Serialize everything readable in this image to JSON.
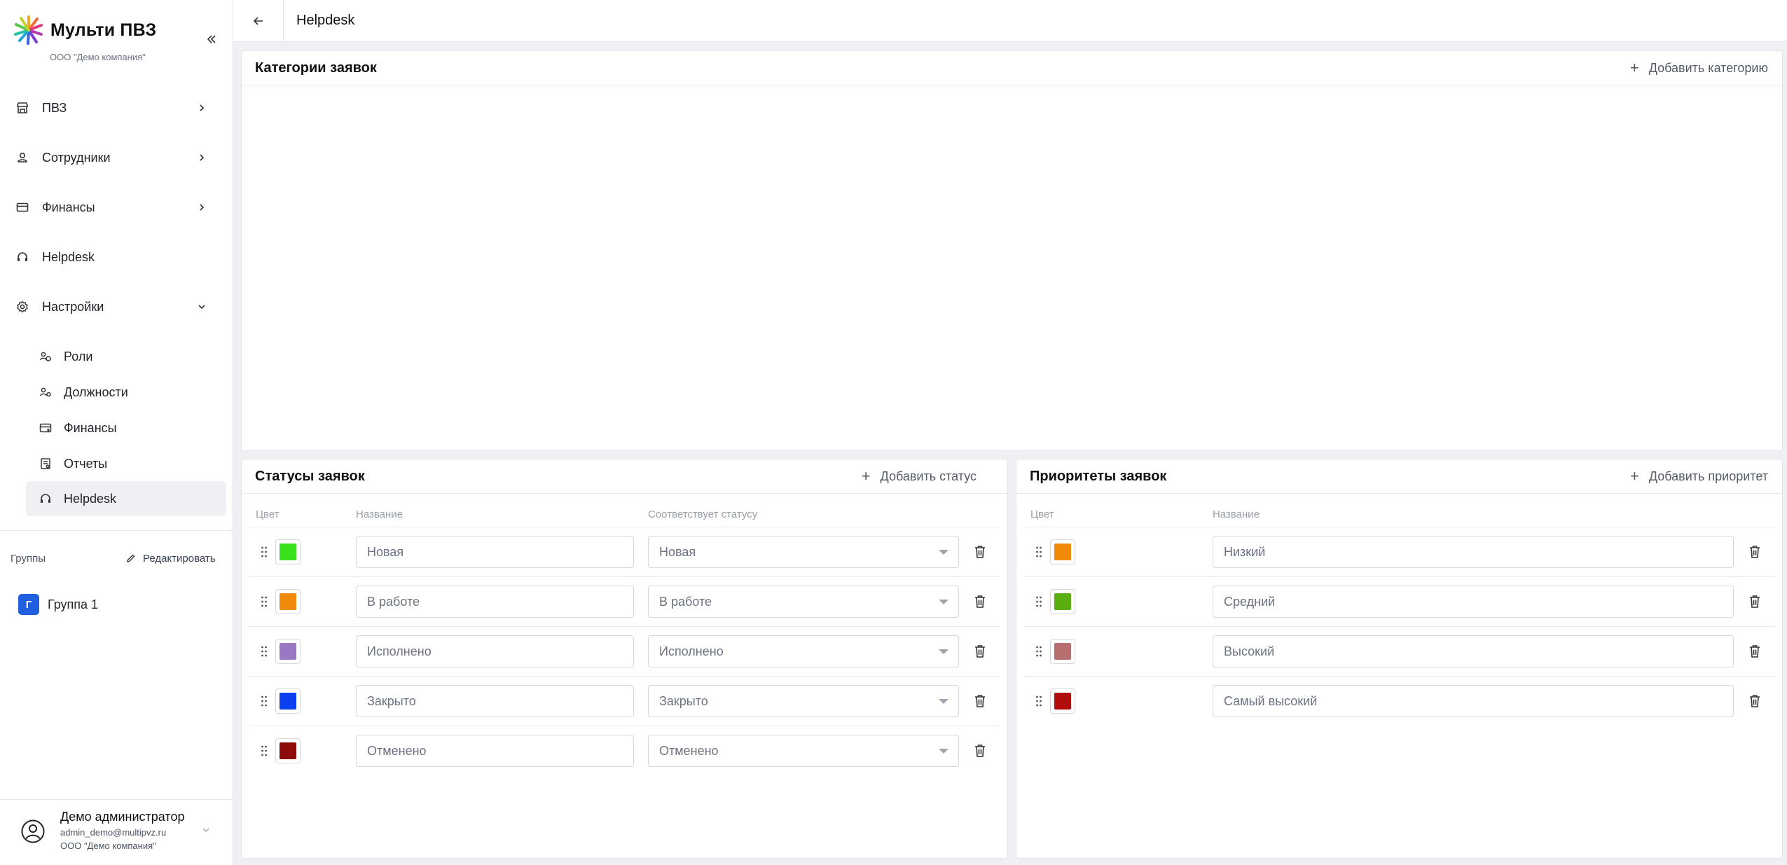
{
  "brand": {
    "title": "Мульти ПВЗ",
    "company": "ООО \"Демо компания\""
  },
  "nav": {
    "items": [
      {
        "label": "ПВЗ",
        "icon": "store-icon",
        "arrow": "right"
      },
      {
        "label": "Сотрудники",
        "icon": "user-icon",
        "arrow": "right"
      },
      {
        "label": "Финансы",
        "icon": "card-icon",
        "arrow": "right"
      },
      {
        "label": "Helpdesk",
        "icon": "headset-icon",
        "arrow": ""
      },
      {
        "label": "Настройки",
        "icon": "gear-icon",
        "arrow": "down"
      }
    ],
    "sub_items": [
      {
        "label": "Роли",
        "icon": "roles-icon"
      },
      {
        "label": "Должности",
        "icon": "positions-icon"
      },
      {
        "label": "Финансы",
        "icon": "finance-settings-icon"
      },
      {
        "label": "Отчеты",
        "icon": "reports-icon"
      },
      {
        "label": "Helpdesk",
        "icon": "headset-icon",
        "active": true
      }
    ]
  },
  "groups": {
    "label": "Группы",
    "edit_label": "Редактировать",
    "items": [
      {
        "badge": "Г",
        "name": "Группа 1"
      }
    ]
  },
  "user": {
    "name": "Демо администратор",
    "email": "admin_demo@multipvz.ru",
    "company": "ООО \"Демо компания\""
  },
  "topbar": {
    "title": "Helpdesk"
  },
  "categories": {
    "title": "Категории заявок",
    "add_label": "Добавить категорию"
  },
  "statuses": {
    "title": "Статусы заявок",
    "add_label": "Добавить статус",
    "columns": {
      "color": "Цвет",
      "name": "Название",
      "matches": "Соответствует статусу"
    },
    "rows": [
      {
        "color": "#39e01c",
        "name": "Новая",
        "matches": "Новая"
      },
      {
        "color": "#f08a0a",
        "name": "В работе",
        "matches": "В работе"
      },
      {
        "color": "#9a78c4",
        "name": "Исполнено",
        "matches": "Исполнено"
      },
      {
        "color": "#0b3ff0",
        "name": "Закрыто",
        "matches": "Закрыто"
      },
      {
        "color": "#8e0b0b",
        "name": "Отменено",
        "matches": "Отменено"
      }
    ]
  },
  "priorities": {
    "title": "Приоритеты заявок",
    "add_label": "Добавить приоритет",
    "columns": {
      "color": "Цвет",
      "name": "Название"
    },
    "rows": [
      {
        "color": "#f08a0a",
        "name": "Низкий"
      },
      {
        "color": "#5aae10",
        "name": "Средний"
      },
      {
        "color": "#b86e6e",
        "name": "Высокий"
      },
      {
        "color": "#b00d0d",
        "name": "Самый высокий"
      }
    ]
  }
}
